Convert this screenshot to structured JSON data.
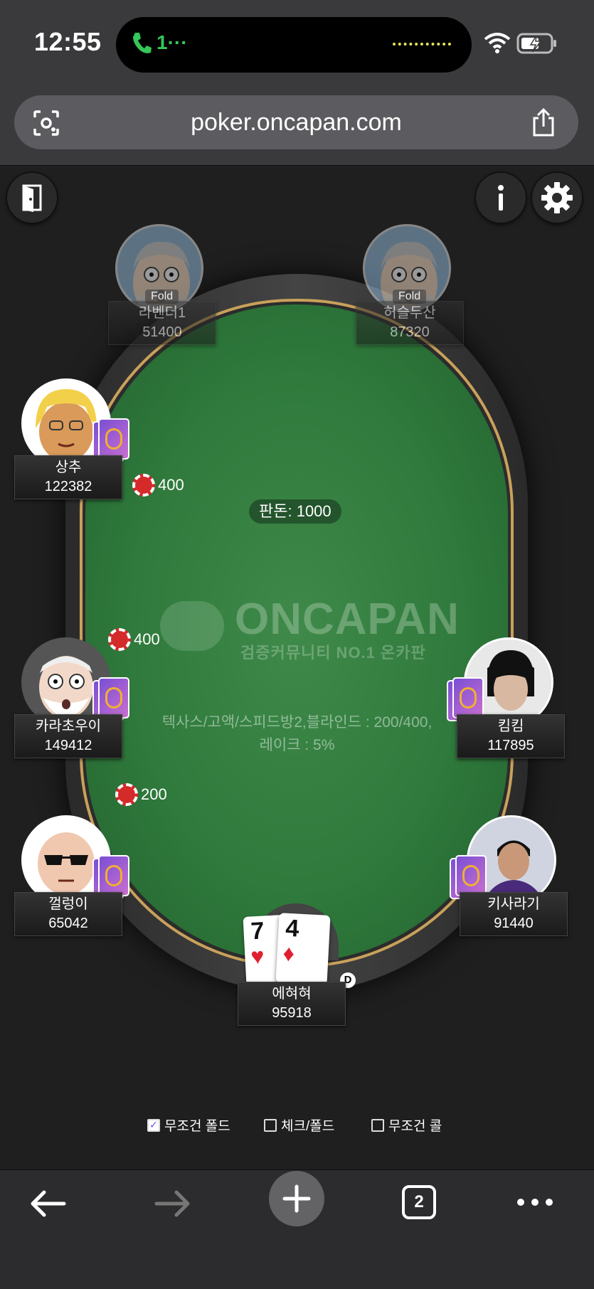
{
  "status": {
    "time": "12:55",
    "call": "1···"
  },
  "browser": {
    "url": "poker.oncapan.com",
    "tab_count": "2"
  },
  "table": {
    "pot_label": "판돈: 1000",
    "logo_title": "ONCAPAN",
    "logo_subtitle": "검증커뮤니티 NO.1 온카판",
    "info_line1": "텍사스/고액/스피드방2,블라인드 : 200/400,",
    "info_line2": "레이크 : 5%"
  },
  "players": [
    {
      "name": "라벤더1",
      "chips": "51400",
      "status": "Fold"
    },
    {
      "name": "허슬두산",
      "chips": "87320",
      "status": "Fold"
    },
    {
      "name": "상추",
      "chips": "122382",
      "bet": "400"
    },
    {
      "name": "카라초우이",
      "chips": "149412",
      "bet": "400"
    },
    {
      "name": "껄렁이",
      "chips": "65042",
      "bet": "200"
    },
    {
      "name": "킴킴",
      "chips": "117895"
    },
    {
      "name": "키사라기",
      "chips": "91440"
    },
    {
      "name": "에혀혀",
      "chips": "95918",
      "cards": [
        {
          "rank": "7",
          "suit": "♥"
        },
        {
          "rank": "4",
          "suit": "♦"
        }
      ],
      "dealer": "D"
    }
  ],
  "options": [
    {
      "label": "무조건 폴드",
      "checked": true
    },
    {
      "label": "체크/폴드",
      "checked": false
    },
    {
      "label": "무조건 콜",
      "checked": false
    }
  ],
  "colors": {
    "felt": "#2f7a3c",
    "rail_gold": "#c9a15a",
    "chip": "#d42a2a",
    "accent_check": "#6b4bff"
  }
}
